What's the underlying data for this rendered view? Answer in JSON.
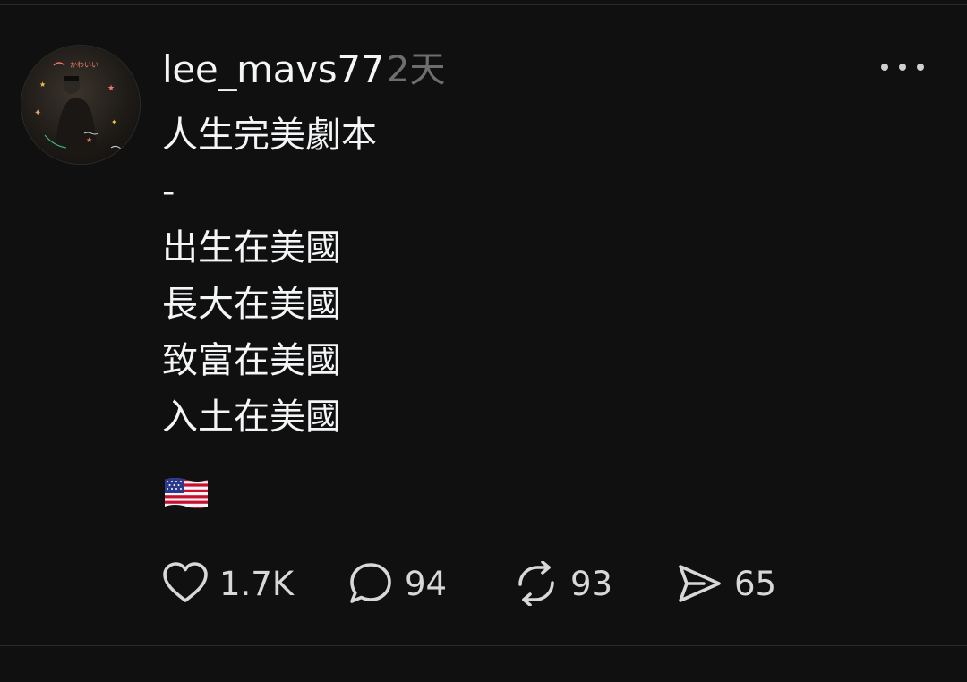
{
  "post": {
    "username": "lee_mavs77",
    "timestamp": "2天",
    "lines": [
      "人生完美劇本",
      "-",
      "出生在美國",
      "長大在美國",
      "致富在美國",
      "入土在美國"
    ],
    "emoji": "us-flag"
  },
  "actions": {
    "likes": "1.7K",
    "replies": "94",
    "reposts": "93",
    "shares": "65"
  },
  "icons": {
    "like": "heart-icon",
    "reply": "speech-bubble-icon",
    "repost": "repost-arrows-icon",
    "share": "send-icon",
    "more": "more-dots-icon"
  },
  "colors": {
    "background": "#101010",
    "text": "#f3f5f7",
    "muted": "#6e6e6e"
  }
}
